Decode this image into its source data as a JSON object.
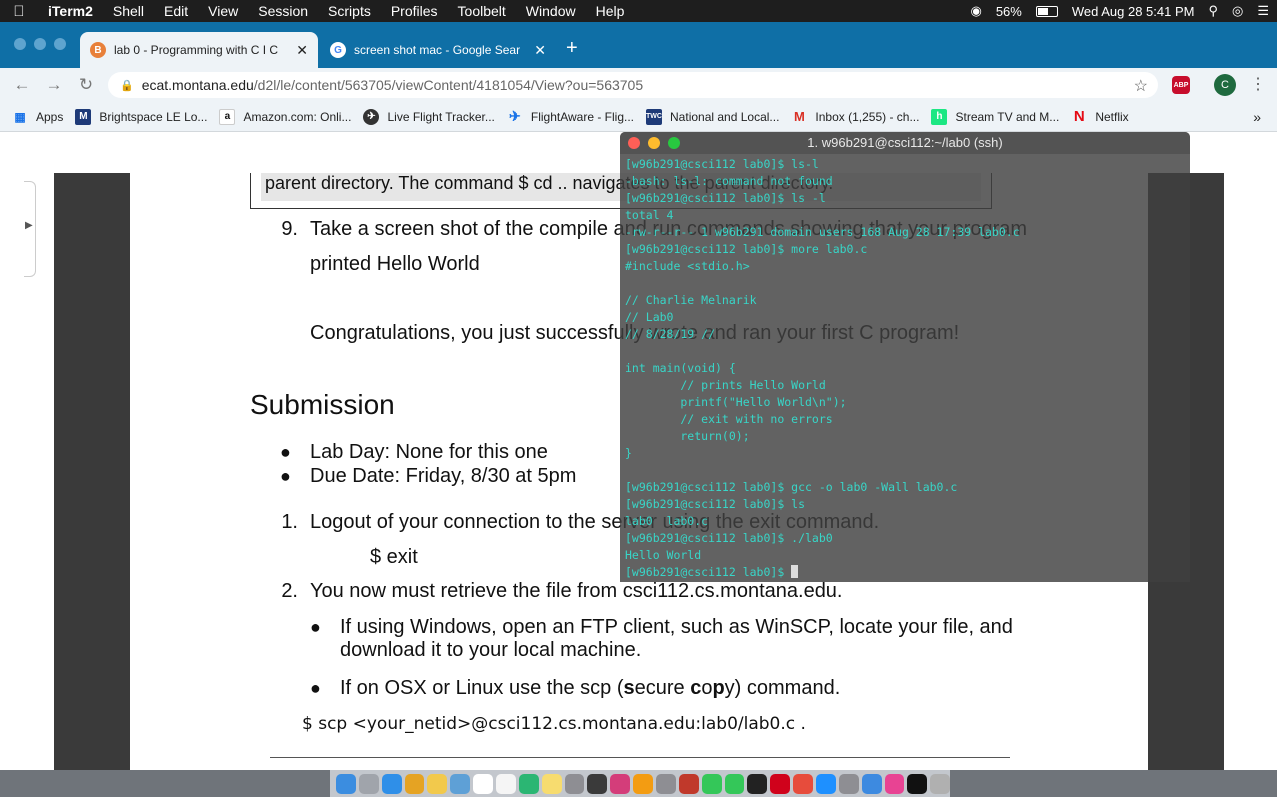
{
  "menubar": {
    "apple": "",
    "app_name": "iTerm2",
    "items": [
      "Shell",
      "Edit",
      "View",
      "Session",
      "Scripts",
      "Profiles",
      "Toolbelt",
      "Window",
      "Help"
    ],
    "battery": "56%",
    "clock": "Wed Aug 28  5:41 PM"
  },
  "tabs": [
    {
      "title": "lab 0 - Programming with C I C",
      "favicon": "brightspace-icon"
    },
    {
      "title": "screen shot mac - Google Sear",
      "favicon": "google-icon"
    }
  ],
  "toolbar": {
    "url_host": "ecat.montana.edu",
    "url_path": "/d2l/le/content/563705/viewContent/4181054/View?ou=563705",
    "profile_initial": "C",
    "abp_label": "ABP"
  },
  "bookmarks": [
    {
      "label": "Apps",
      "icon": "apps-grid-icon",
      "color": "#1a73e8"
    },
    {
      "label": "Brightspace LE Lo...",
      "icon": "montana-state-icon",
      "color": "#1e3a78"
    },
    {
      "label": "Amazon.com: Onli...",
      "icon": "amazon-icon",
      "color": "#ffffff"
    },
    {
      "label": "Live Flight Tracker...",
      "icon": "flightradar-icon",
      "color": "#333333"
    },
    {
      "label": "FlightAware - Flig...",
      "icon": "flightaware-icon",
      "color": "#1a73e8"
    },
    {
      "label": "National and Local...",
      "icon": "weather-channel-icon",
      "color": "#1e3a78"
    },
    {
      "label": "Inbox (1,255) - ch...",
      "icon": "gmail-icon",
      "color": "#d93025"
    },
    {
      "label": "Stream TV and M...",
      "icon": "hulu-icon",
      "color": "#1ce783"
    },
    {
      "label": "Netflix",
      "icon": "netflix-icon",
      "color": "#e50914"
    }
  ],
  "doc": {
    "box_text": "parent directory. The command $ cd .. navigates to the parent directory.",
    "step9_num": "9.",
    "step9_line1": "Take a screen shot of the compile and run commands showing that your program",
    "step9_line2": "printed Hello World",
    "congrats": "Congratulations, you just successfully wrote and ran your first C program!",
    "submission_heading": "Submission",
    "lab_day": "Lab Day: None for this one",
    "due_date": "Due Date: Friday, 8/30 at 5pm",
    "step1_num": "1.",
    "step1": "Logout of your connection to the server using the exit command.",
    "exit_cmd": "$ exit",
    "step2_num": "2.",
    "step2": "You now must retrieve the file from csci112.cs.montana.edu.",
    "windows_line1": "If using Windows, open an FTP client, such as WinSCP, locate your file, and",
    "windows_line2": "download it to your local machine.",
    "osx_pre": "If on OSX or Linux use the scp (",
    "osx_s": "s",
    "osx_ecure": "ecure ",
    "osx_c": "c",
    "osx_o": "o",
    "osx_p": "p",
    "osx_y": "y",
    "osx_post": ") command.",
    "scp_cmd": "$ scp <your_netid>@csci112.cs.montana.edu:lab0/lab0.c ."
  },
  "terminal": {
    "title": "1. w96b291@csci112:~/lab0 (ssh)",
    "lines": [
      "[w96b291@csci112 lab0]$ ls-l",
      "-bash: ls-l: command not found",
      "[w96b291@csci112 lab0]$ ls -l",
      "total 4",
      "-rw-r--r-- 1 w96b291 domain users 168 Aug 28 17:39 lab0.c",
      "[w96b291@csci112 lab0]$ more lab0.c",
      "#include <stdio.h>",
      "",
      "// Charlie Melnarik",
      "// Lab0",
      "// 8/28/19 //",
      "",
      "int main(void) {",
      "        // prints Hello World",
      "        printf(\"Hello World\\n\");",
      "        // exit with no errors",
      "        return(0);",
      "}",
      "",
      "[w96b291@csci112 lab0]$ gcc -o lab0 -Wall lab0.c",
      "[w96b291@csci112 lab0]$ ls",
      "lab0  lab0.c",
      "[w96b291@csci112 lab0]$ ./lab0",
      "Hello World",
      "[w96b291@csci112 lab0]$ "
    ]
  },
  "dock": {
    "icons": [
      "finder-icon",
      "launchpad-icon",
      "safari-icon",
      "chrome-icon",
      "notes-icon",
      "preview-icon",
      "calendar-icon",
      "textedit-icon",
      "pycharm-icon",
      "stickies-icon",
      "disk-utility-icon",
      "activity-monitor-icon",
      "intellij-icon",
      "photos-icon",
      "system-prefs-icon",
      "photo-booth-icon",
      "messages-icon",
      "facetime-icon",
      "terminal-icon",
      "parallels-icon",
      "no-entry-icon",
      "app-store-icon",
      "system-preferences-icon",
      "mail-icon",
      "itunes-icon",
      "iterm-icon",
      "trash-icon"
    ]
  }
}
